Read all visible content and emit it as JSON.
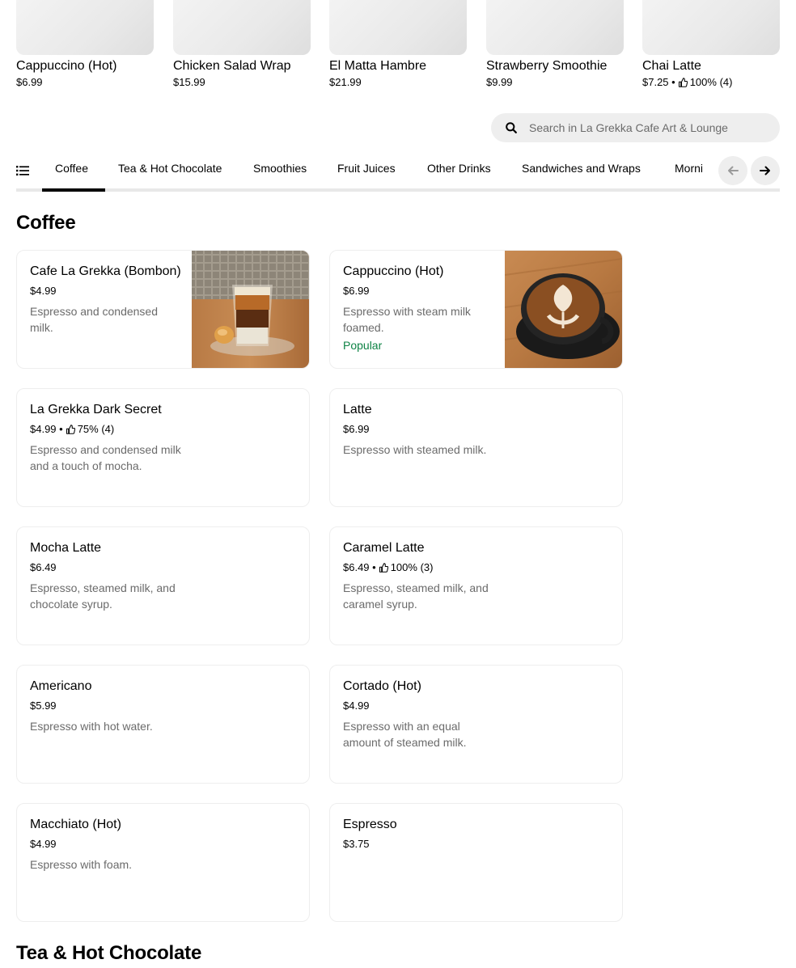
{
  "featured": [
    {
      "name": "Cappuccino (Hot)",
      "price": "$6.99"
    },
    {
      "name": "Chicken Salad Wrap",
      "price": "$15.99"
    },
    {
      "name": "El Matta Hambre",
      "price": "$21.99"
    },
    {
      "name": "Strawberry Smoothie",
      "price": "$9.99"
    },
    {
      "name": "Chai Latte",
      "price": "$7.25 •",
      "rating": "100% (4)"
    }
  ],
  "search": {
    "placeholder": "Search in La Grekka Cafe Art & Lounge",
    "value": ""
  },
  "tabs": [
    "Coffee",
    "Tea & Hot Chocolate",
    "Smoothies",
    "Fruit Juices",
    "Other Drinks",
    "Sandwiches and Wraps",
    "Morni"
  ],
  "active_tab": "Coffee",
  "sections": {
    "coffee": {
      "title": "Coffee",
      "items": [
        {
          "name": "Cafe La Grekka (Bombon)",
          "price": "$4.99",
          "rating": "",
          "description": "Espresso and condensed milk.",
          "badge": "",
          "photo": "bombon-photo"
        },
        {
          "name": "Cappuccino (Hot)",
          "price": "$6.99",
          "rating": "",
          "description": "Espresso with steam milk foamed.",
          "badge": "Popular",
          "photo": "cappuccino-photo"
        },
        {
          "name": "La Grekka Dark Secret",
          "price": "$4.99 •",
          "rating": "75% (4)",
          "description": "Espresso and condensed milk and a touch of mocha.",
          "badge": ""
        },
        {
          "name": "Latte",
          "price": "$6.99",
          "rating": "",
          "description": "Espresso with steamed milk.",
          "badge": ""
        },
        {
          "name": "Mocha Latte",
          "price": "$6.49",
          "rating": "",
          "description": "Espresso, steamed milk, and chocolate syrup.",
          "badge": ""
        },
        {
          "name": "Caramel Latte",
          "price": "$6.49 •",
          "rating": "100% (3)",
          "description": "Espresso, steamed milk, and caramel syrup.",
          "badge": ""
        },
        {
          "name": "Americano",
          "price": "$5.99",
          "rating": "",
          "description": "Espresso with hot water.",
          "badge": ""
        },
        {
          "name": "Cortado (Hot)",
          "price": "$4.99",
          "rating": "",
          "description": "Espresso with an equal amount of steamed milk.",
          "badge": ""
        },
        {
          "name": "Macchiato (Hot)",
          "price": "$4.99",
          "rating": "",
          "description": "Espresso with foam.",
          "badge": ""
        },
        {
          "name": "Espresso",
          "price": "$3.75",
          "rating": "",
          "description": "",
          "badge": ""
        }
      ]
    },
    "tea": {
      "title": "Tea & Hot Chocolate"
    }
  },
  "colors": {
    "accent": "#000000",
    "popular": "#0e8345",
    "muted_text": "#6b6b6b",
    "chip_bg": "#eeeeee"
  }
}
